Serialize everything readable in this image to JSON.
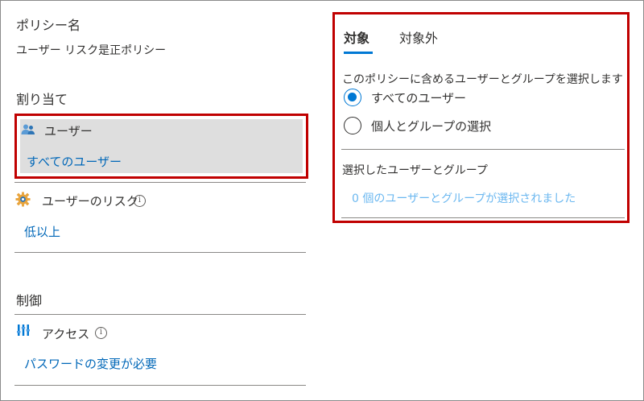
{
  "policy": {
    "name_label": "ポリシー名",
    "name_value": "ユーザー リスク是正ポリシー"
  },
  "assignments": {
    "heading": "割り当て",
    "users": {
      "label": "ユーザー",
      "value": "すべてのユーザー"
    },
    "user_risk": {
      "label": "ユーザーのリスク",
      "value": "低以上"
    }
  },
  "controls": {
    "heading": "制御",
    "access": {
      "label": "アクセス",
      "value": "パスワードの変更が必要"
    }
  },
  "panel": {
    "tabs": [
      {
        "label": "対象",
        "active": true
      },
      {
        "label": "対象外",
        "active": false
      }
    ],
    "instruction": "このポリシーに含めるユーザーとグループを選択します",
    "options": [
      {
        "label": "すべてのユーザー",
        "checked": true
      },
      {
        "label": "個人とグループの選択",
        "checked": false
      }
    ],
    "selected_heading": "選択したユーザーとグループ",
    "selected_status": "0 個のユーザーとグループが選択されました"
  },
  "colors": {
    "accent": "#0078d4",
    "link": "#0067b8",
    "highlight_border": "#c00000",
    "selected_bg": "#dedede"
  }
}
